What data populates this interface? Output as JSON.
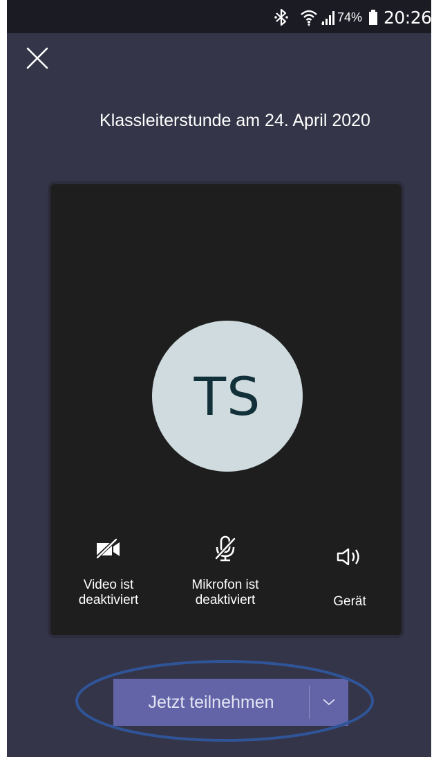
{
  "status_bar": {
    "battery_percent": "74%",
    "time": "20:26",
    "icons": [
      "bluetooth-icon",
      "wifi-icon",
      "signal-icon",
      "battery-icon"
    ]
  },
  "meeting": {
    "title": "Klassleiterstunde am 24. April 2020"
  },
  "avatar": {
    "initials": "TS",
    "bg_color": "#cfdbde"
  },
  "controls": {
    "video": {
      "label_line1": "Video ist",
      "label_line2": "deaktiviert",
      "icon": "camera-off-icon"
    },
    "mic": {
      "label_line1": "Mikrofon ist",
      "label_line2": "deaktiviert",
      "icon": "mic-off-icon"
    },
    "device": {
      "label": "Gerät",
      "icon": "speaker-icon"
    }
  },
  "join": {
    "label": "Jetzt teilnehmen",
    "accent_color": "#6264a7"
  },
  "colors": {
    "background": "#353549",
    "status_bar": "#1b1b24",
    "card": "#1e1e1e",
    "annotation": "#2f5598"
  }
}
